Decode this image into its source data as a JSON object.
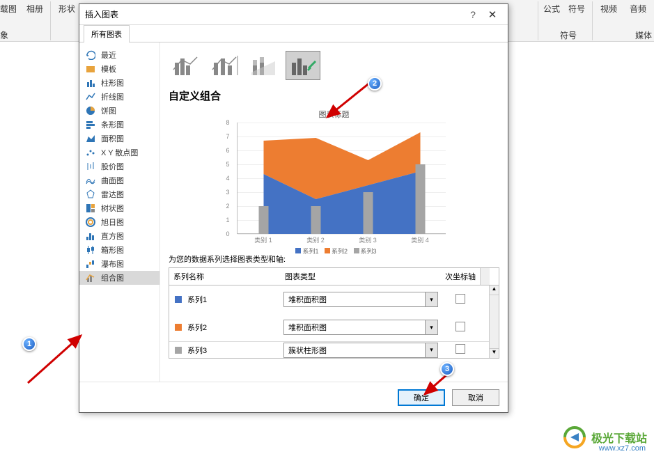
{
  "ribbon": {
    "items_left": [
      "载图",
      "相册",
      "形状"
    ],
    "items_right": [
      "公式",
      "符号",
      "视频",
      "音频"
    ],
    "groups_right": [
      "符号",
      "媒体"
    ],
    "obj_label": "象"
  },
  "dialog": {
    "title": "插入图表",
    "help": "?",
    "close": "✕",
    "tab": "所有图表"
  },
  "sidebar": {
    "items": [
      {
        "icon": "recent",
        "label": "最近"
      },
      {
        "icon": "template",
        "label": "模板"
      },
      {
        "icon": "column",
        "label": "柱形图"
      },
      {
        "icon": "line",
        "label": "折线图"
      },
      {
        "icon": "pie",
        "label": "饼图"
      },
      {
        "icon": "bar",
        "label": "条形图"
      },
      {
        "icon": "area",
        "label": "面积图"
      },
      {
        "icon": "scatter",
        "label": "X Y 散点图"
      },
      {
        "icon": "stock",
        "label": "股价图"
      },
      {
        "icon": "surface",
        "label": "曲面图"
      },
      {
        "icon": "radar",
        "label": "雷达图"
      },
      {
        "icon": "treemap",
        "label": "树状图"
      },
      {
        "icon": "sunburst",
        "label": "旭日图"
      },
      {
        "icon": "histogram",
        "label": "直方图"
      },
      {
        "icon": "boxwhisker",
        "label": "箱形图"
      },
      {
        "icon": "waterfall",
        "label": "瀑布图"
      },
      {
        "icon": "combo",
        "label": "组合图"
      }
    ],
    "selected": 16
  },
  "main": {
    "section_title": "自定义组合",
    "chart_title": "图表标题",
    "legend": [
      "系列1",
      "系列2",
      "系列3"
    ],
    "colors": {
      "s1": "#4472c4",
      "s2": "#ed7d31",
      "s3": "#a5a5a5"
    },
    "series_instruction": "为您的数据系列选择图表类型和轴:",
    "table_headers": {
      "name": "系列名称",
      "type": "图表类型",
      "axis": "次坐标轴"
    },
    "series_rows": [
      {
        "color": "#4472c4",
        "name": "系列1",
        "type": "堆积面积图",
        "secondary": false
      },
      {
        "color": "#ed7d31",
        "name": "系列2",
        "type": "堆积面积图",
        "secondary": false
      },
      {
        "color": "#a5a5a5",
        "name": "系列3",
        "type": "簇状柱形图",
        "secondary": false
      }
    ]
  },
  "chart_data": {
    "type": "combo",
    "title": "图表标题",
    "categories": [
      "类别 1",
      "类别 2",
      "类别 3",
      "类别 4"
    ],
    "ylim": [
      0,
      8
    ],
    "yticks": [
      0,
      1,
      2,
      3,
      4,
      5,
      6,
      7,
      8
    ],
    "series": [
      {
        "name": "系列1",
        "type": "area_stacked",
        "color": "#4472c4",
        "values": [
          4.3,
          2.5,
          3.5,
          4.5
        ]
      },
      {
        "name": "系列2",
        "type": "area_stacked",
        "color": "#ed7d31",
        "values": [
          2.4,
          4.4,
          1.8,
          2.8
        ]
      },
      {
        "name": "系列3",
        "type": "column",
        "color": "#a5a5a5",
        "values": [
          2.0,
          2.0,
          3.0,
          5.0
        ]
      }
    ]
  },
  "footer": {
    "ok": "确定",
    "cancel": "取消"
  },
  "badges": {
    "b1": "1",
    "b2": "2",
    "b3": "3"
  },
  "watermark": {
    "text": "极光下载站",
    "url": "www.xz7.com"
  }
}
